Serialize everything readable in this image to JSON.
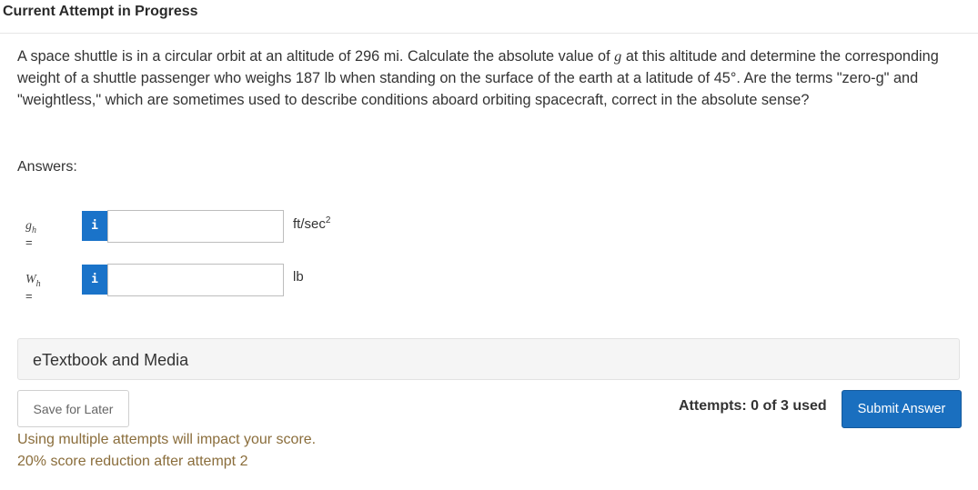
{
  "header": {
    "title": "Current Attempt in Progress"
  },
  "question": {
    "text_before_g": "A space shuttle is in a circular orbit at an altitude of 296 mi. Calculate the absolute value of ",
    "g_symbol": "g",
    "text_after_g": " at this altitude and determine the corresponding weight of a shuttle passenger who weighs 187 lb when standing on the surface of the earth at a latitude of 45°. Are the terms \"zero-g\" and \"weightless,\" which are sometimes used to describe conditions aboard orbiting spacecraft, correct in the absolute sense?"
  },
  "answers_label": "Answers:",
  "answers": [
    {
      "var": "g",
      "sub": "h",
      "eq": " =",
      "info": "i",
      "value": "",
      "unit": "ft/sec",
      "unit_sup": "2"
    },
    {
      "var": "W",
      "sub": "h",
      "eq": " =",
      "info": "i",
      "value": "",
      "unit": "lb",
      "unit_sup": ""
    }
  ],
  "etextbook_label": "eTextbook and Media",
  "save_label": "Save for Later",
  "attempts_text": "Attempts: 0 of 3 used",
  "submit_label": "Submit Answer",
  "warning_line1": "Using multiple attempts will impact your score.",
  "warning_line2": "20% score reduction after attempt 2",
  "colors": {
    "accent": "#1a6fbf",
    "info_button": "#1a73c9",
    "warning_text": "#8a6d3b"
  }
}
